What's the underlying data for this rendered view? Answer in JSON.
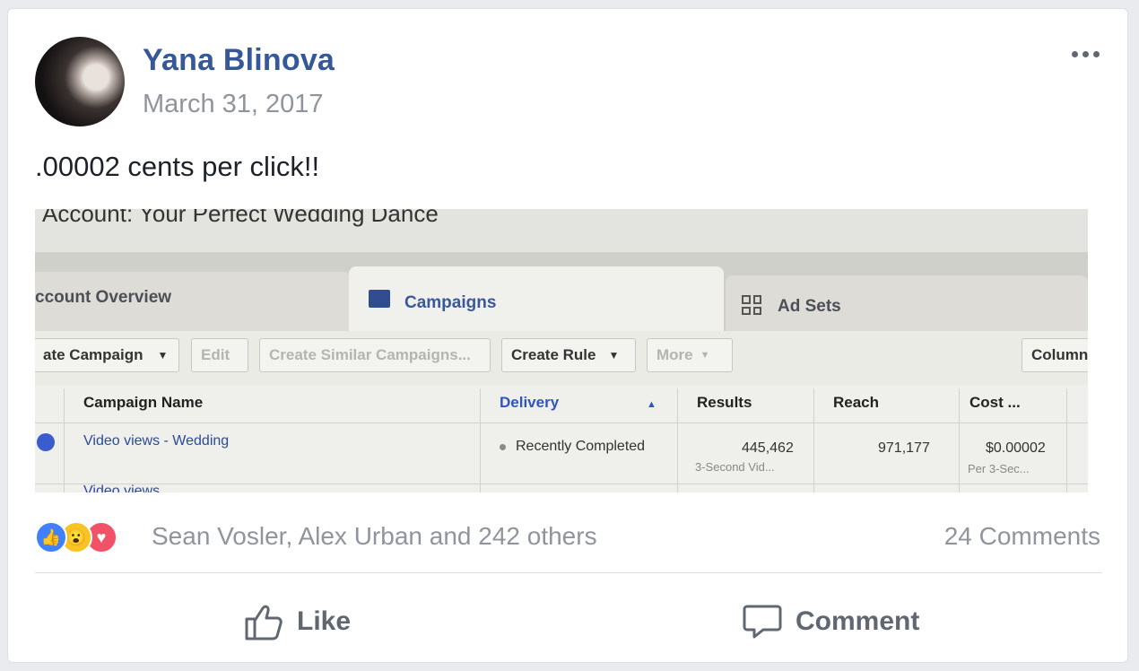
{
  "post": {
    "author": "Yana Blinova",
    "date": "March 31, 2017",
    "text": ".00002 cents per click!!",
    "more_icon": "ellipsis-icon"
  },
  "photo": {
    "account_label": "Account: Your Perfect Wedding Dance",
    "tabs": [
      "ccount Overview",
      "Campaigns",
      "Ad Sets"
    ],
    "toolbar": [
      "ate Campaign",
      "Edit",
      "Create Similar Campaigns...",
      "Create Rule",
      "More",
      "Column"
    ],
    "columns": [
      "Campaign Name",
      "Delivery",
      "Results",
      "Reach",
      "Cost ..."
    ],
    "row": {
      "name": "Video views - Wedding",
      "delivery": "Recently Completed",
      "results": "445,462",
      "results_sub": "3-Second Vid...",
      "reach": "971,177",
      "cost": "$0.00002",
      "cost_sub": "Per 3-Sec..."
    },
    "next_row_partial": "Video views"
  },
  "reactions": {
    "icons": [
      "like-reaction-icon",
      "wow-reaction-icon",
      "love-reaction-icon"
    ],
    "summary": "Sean Vosler, Alex Urban and 242 others",
    "comments": "24 Comments"
  },
  "actions": {
    "like": "Like",
    "comment": "Comment"
  },
  "colors": {
    "author_link": "#365899",
    "meta_gray": "#90949c",
    "like_blue": "#4080ff",
    "love_red": "#f25268",
    "wow_yellow": "#f7c325"
  }
}
